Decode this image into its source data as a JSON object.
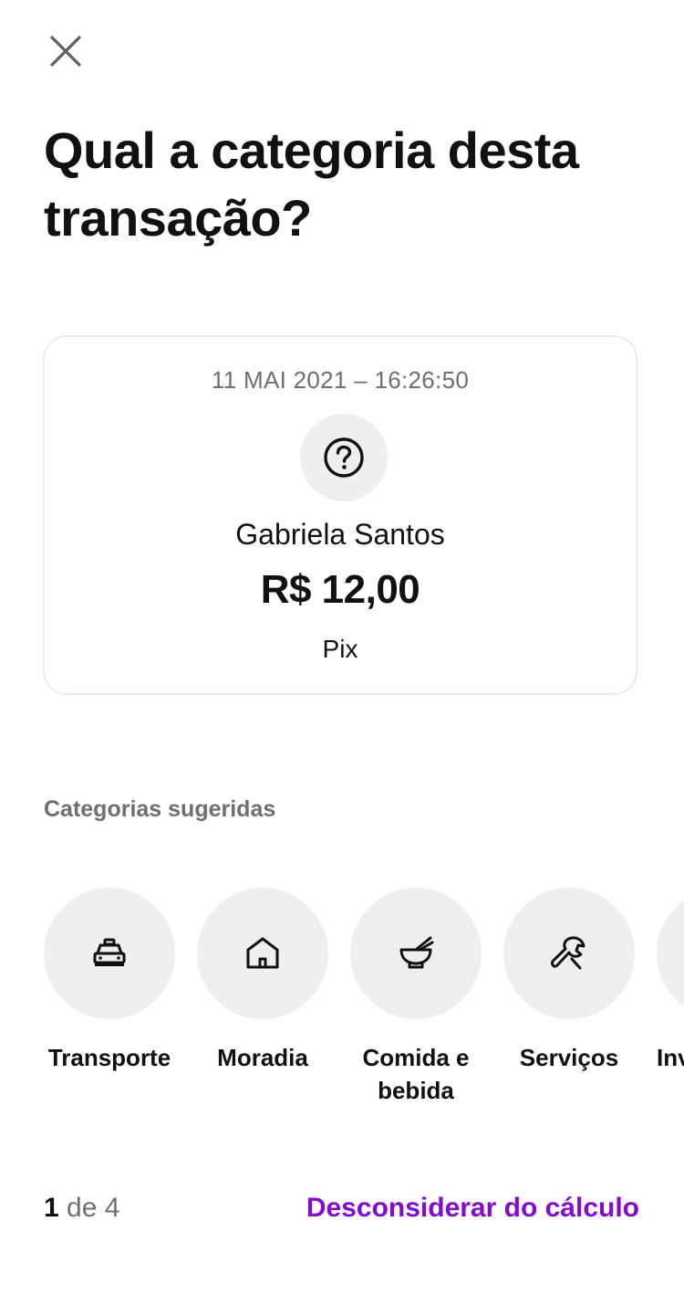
{
  "header": {
    "close_icon": "close-icon",
    "title": "Qual a categoria desta transação?"
  },
  "transaction": {
    "datetime": "11 MAI 2021 – 16:26:50",
    "icon": "question-circle-icon",
    "name": "Gabriela Santos",
    "amount": "R$ 12,00",
    "method": "Pix"
  },
  "suggested": {
    "label": "Categorias sugeridas",
    "items": [
      {
        "label": "Transporte",
        "icon": "taxi-icon"
      },
      {
        "label": "Moradia",
        "icon": "house-icon"
      },
      {
        "label": "Comida e bebida",
        "icon": "bowl-icon"
      },
      {
        "label": "Serviços",
        "icon": "wrench-icon"
      },
      {
        "label": "Inv",
        "icon": "investment-icon"
      }
    ]
  },
  "footer": {
    "current": "1",
    "of_total": " de 4",
    "discard_label": "Desconsiderar do cálculo"
  },
  "colors": {
    "accent": "#820ad1",
    "muted_text": "#6e6e74",
    "circle_bg": "#efeff1",
    "card_border": "#ececee"
  }
}
